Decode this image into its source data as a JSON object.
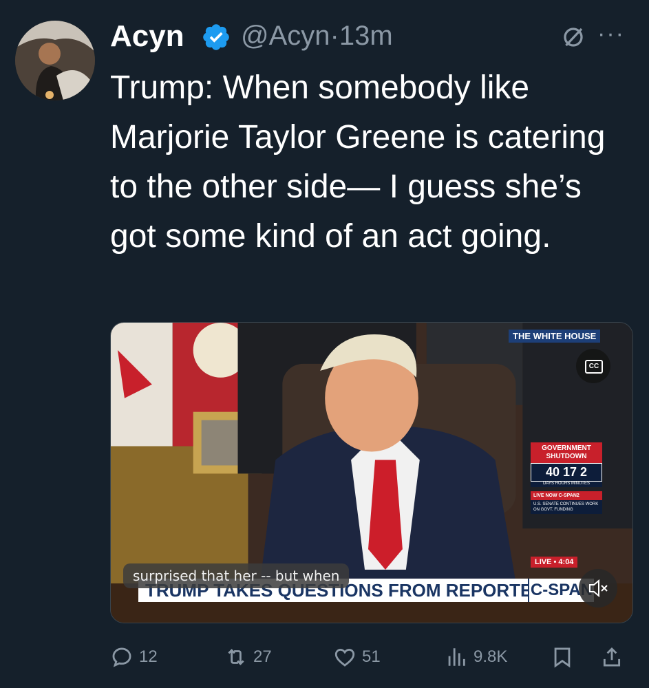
{
  "tweet": {
    "display_name": "Acyn",
    "handle": "@Acyn",
    "separator": "·",
    "time": "13m",
    "more": "···",
    "text": "Trump: When somebody like Marjorie Taylor Greene is catering to the other side— I guess she’s got some kind of an act going."
  },
  "video": {
    "caption": "surprised that her -- but when",
    "lower_third": "TRUMP TAKES QUESTIONS FROM REPORTERS",
    "network": "C-SPAN",
    "location_label": "THE WHITE HOUSE",
    "time_label": "4:04",
    "cc_label": "CC",
    "gov_header": "GOVERNMENT SHUTDOWN",
    "gov_counter": "40 17 2",
    "gov_units": "DAYS HOURS MINUTES",
    "gov_live_label": "LIVE NOW C-SPAN2",
    "gov_live_text": "U.S. SENATE CONTINUES WORK ON GOVT. FUNDING",
    "live_tag": "LIVE • 4:04"
  },
  "actions": {
    "replies": "12",
    "reposts": "27",
    "likes": "51",
    "views": "9.8K"
  },
  "colors": {
    "background": "#15202b",
    "secondary_text": "#8b98a5",
    "verified": "#1d9bf0"
  },
  "icons": [
    "verified-badge-icon",
    "mute-icon",
    "more-icon",
    "reply-icon",
    "repost-icon",
    "like-icon",
    "views-icon",
    "bookmark-icon",
    "share-icon",
    "cc-icon",
    "sound-off-icon"
  ]
}
